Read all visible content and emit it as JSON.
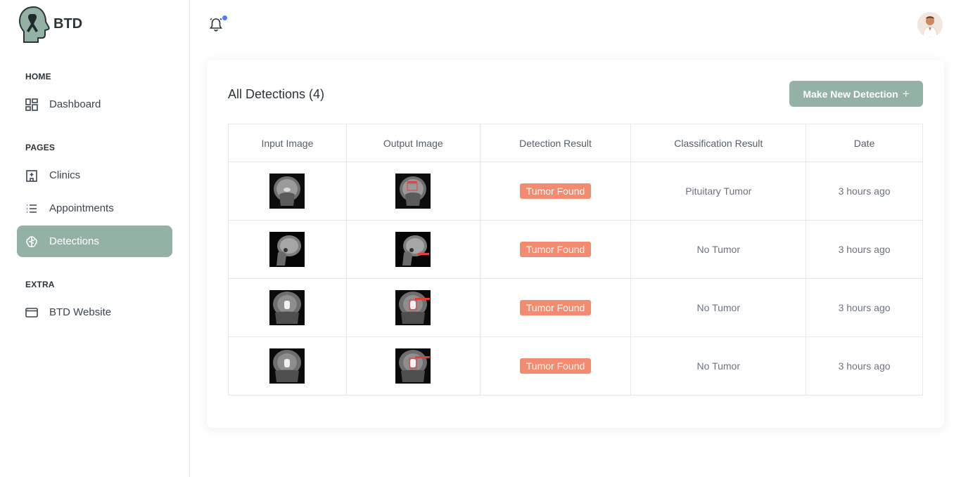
{
  "brand": {
    "name": "BTD",
    "logo_icon": "head-ribbon-icon"
  },
  "sidebar": {
    "sections": [
      {
        "label": "HOME",
        "items": [
          {
            "label": "Dashboard",
            "icon": "dashboard-icon",
            "active": false
          }
        ]
      },
      {
        "label": "PAGES",
        "items": [
          {
            "label": "Clinics",
            "icon": "hospital-icon",
            "active": false
          },
          {
            "label": "Appointments",
            "icon": "list-icon",
            "active": false
          },
          {
            "label": "Detections",
            "icon": "brain-icon",
            "active": true
          }
        ]
      },
      {
        "label": "EXTRA",
        "items": [
          {
            "label": "BTD Website",
            "icon": "browser-window-icon",
            "active": false
          }
        ]
      }
    ]
  },
  "topbar": {
    "bell_icon": "bell-icon",
    "has_notification": true,
    "avatar": "user-avatar"
  },
  "main": {
    "title": "All Detections (4)",
    "new_button": "Make New Detection",
    "new_button_icon": "+",
    "columns": [
      "Input Image",
      "Output Image",
      "Detection Result",
      "Classification Result",
      "Date"
    ],
    "rows": [
      {
        "detection": "Tumor Found",
        "classification": "Pituitary Tumor",
        "date": "3 hours ago"
      },
      {
        "detection": "Tumor Found",
        "classification": "No Tumor",
        "date": "3 hours ago"
      },
      {
        "detection": "Tumor Found",
        "classification": "No Tumor",
        "date": "3 hours ago"
      },
      {
        "detection": "Tumor Found",
        "classification": "No Tumor",
        "date": "3 hours ago"
      }
    ]
  },
  "colors": {
    "accent": "#94b1a5",
    "badge": "#f28b6f",
    "notification_dot": "#4f7cf0"
  }
}
